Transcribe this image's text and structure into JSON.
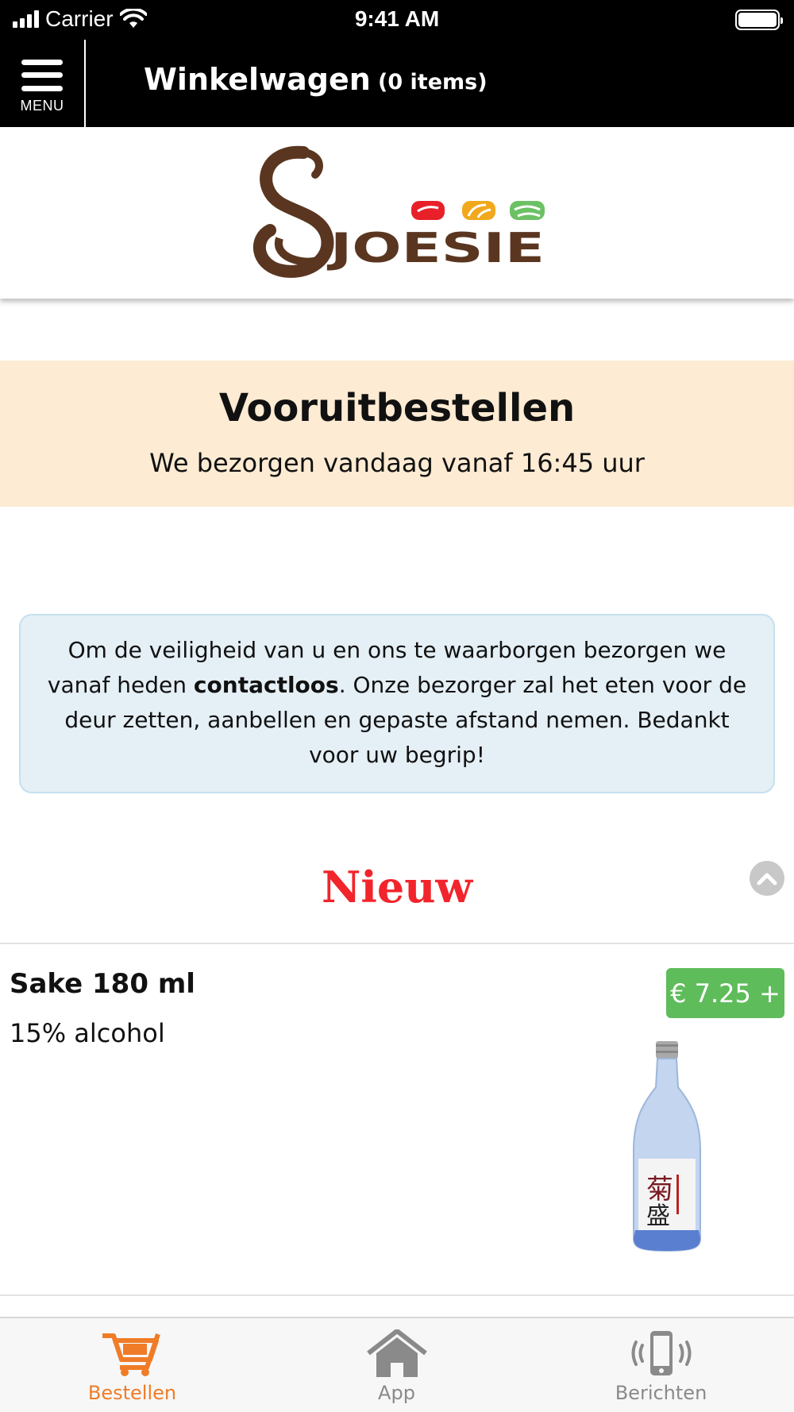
{
  "status_bar": {
    "carrier": "Carrier",
    "time": "9:41 AM"
  },
  "header": {
    "menu_label": "MENU",
    "cart_title": "Winkelwagen",
    "cart_count": "(0 items)"
  },
  "logo": {
    "text": "JOESIE",
    "colors": {
      "brown": "#5a3620",
      "red": "#e8202a",
      "orange": "#f1a81c",
      "green": "#6cc164"
    }
  },
  "banner": {
    "title": "Vooruitbestellen",
    "subtitle": "We bezorgen vandaag vanaf 16:45 uur"
  },
  "notice": {
    "part1": "Om de veiligheid van u en ons te waarborgen bezorgen we vanaf heden ",
    "bold": "contactloos",
    "part2": ". Onze bezorger zal het eten voor de deur zetten, aanbellen en gepaste afstand nemen. Bedankt voor uw begrip!"
  },
  "section": {
    "title": "Nieuw"
  },
  "products": [
    {
      "name": "Sake 180 ml",
      "description": "15% alcohol",
      "price": "€ 7.25 +"
    }
  ],
  "tab_bar": {
    "tabs": [
      {
        "label": "Bestellen",
        "icon": "cart-icon",
        "active": true
      },
      {
        "label": "App",
        "icon": "home-icon",
        "active": false
      },
      {
        "label": "Berichten",
        "icon": "phone-vibrate-icon",
        "active": false
      }
    ],
    "active_color": "#f07c28",
    "inactive_color": "#8a8a8a"
  },
  "colors": {
    "banner_bg": "#fdebd3",
    "notice_bg": "#e5eff6",
    "section_title": "#f1252b",
    "price_bg": "#5fbc5b"
  }
}
